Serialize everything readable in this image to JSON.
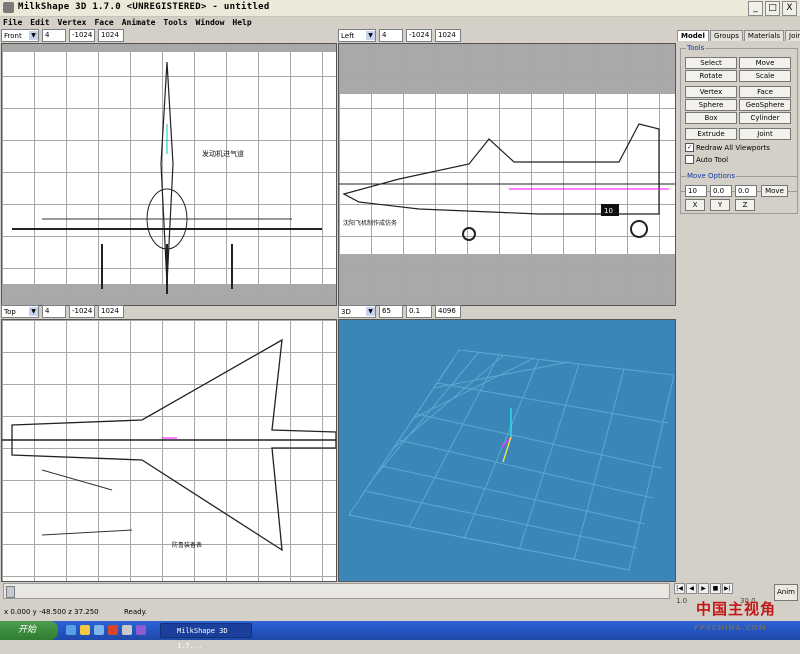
{
  "window": {
    "title": "MilkShape 3D 1.7.0 <UNREGISTERED> - untitled",
    "min": "_",
    "max": "□",
    "close": "X"
  },
  "menu": [
    "File",
    "Edit",
    "Vertex",
    "Face",
    "Animate",
    "Tools",
    "Window",
    "Help"
  ],
  "viewports": {
    "front": {
      "view": "Front",
      "a": "4",
      "b": "-1024",
      "c": "1024",
      "annot": "发动机进气道"
    },
    "left": {
      "view": "Left",
      "a": "4",
      "b": "-1024",
      "c": "1024",
      "annot": "沈阳飞机制作成仿务",
      "part": "10"
    },
    "top": {
      "view": "Top",
      "a": "4",
      "b": "-1024",
      "c": "1024",
      "annot": "防鲁装备表"
    },
    "persp": {
      "view": "3D",
      "a": "65",
      "b": "0.1",
      "c": "4096"
    }
  },
  "panel": {
    "tabs": [
      "Model",
      "Groups",
      "Materials",
      "Joints"
    ],
    "tools_title": "Tools",
    "tools": [
      "Select",
      "Move",
      "Rotate",
      "Scale",
      "Vertex",
      "Face",
      "Sphere",
      "GeoSphere",
      "Box",
      "Cylinder",
      "Extrude",
      "Joint"
    ],
    "redraw": "Redraw All Viewports",
    "autotool": "Auto Tool",
    "move_title": "Move Options",
    "move_x": "10",
    "move_y": "0.0",
    "move_z": "0.0",
    "move_btn": "Move",
    "axes": [
      "X",
      "Y",
      "Z"
    ]
  },
  "status": {
    "coords": "x 0.000 y -48.500 z 37.250",
    "ready": "Ready.",
    "anim": "Anim",
    "frame_a": "1.0",
    "frame_b": "30.0"
  },
  "taskbar": {
    "start": "开始",
    "task": "MilkShape 3D 1.7..."
  },
  "watermark": {
    "main": "中国主视角",
    "sub": "FPSCHINA.COM"
  },
  "colors": {
    "viewport3d": "#3a86b8",
    "grid3d": "#5ea7d3",
    "tab_active": "#ffffff"
  }
}
